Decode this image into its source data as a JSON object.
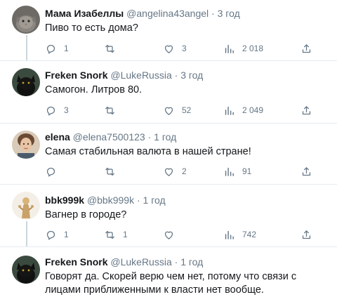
{
  "tweets": [
    {
      "name": "Мама Изабеллы",
      "handle": "@angelina43angel",
      "dot": "·",
      "time": "3 год",
      "text": "Пиво то есть дома?",
      "replies": "1",
      "retweets": "",
      "likes": "3",
      "views": "2 018",
      "avatar": "cat"
    },
    {
      "name": "Freken Snork",
      "handle": "@LukeRussia",
      "dot": "·",
      "time": "3 год",
      "text": "Самогон. Литров 80.",
      "replies": "3",
      "retweets": "",
      "likes": "52",
      "views": "2 049",
      "avatar": "black-cat"
    },
    {
      "name": "elena",
      "handle": "@elena7500123",
      "dot": "·",
      "time": "1 год",
      "text": "Самая стабильная валюта в нашей стране!",
      "replies": "",
      "retweets": "",
      "likes": "2",
      "views": "91",
      "avatar": "portrait"
    },
    {
      "name": "bbk999k",
      "handle": "@bbk999k",
      "dot": "·",
      "time": "1 год",
      "text": "Вагнер в городе?",
      "replies": "1",
      "retweets": "1",
      "likes": "",
      "views": "742",
      "avatar": "statue"
    },
    {
      "name": "Freken Snork",
      "handle": "@LukeRussia",
      "dot": "·",
      "time": "1 год",
      "text": "Говорят да. Скорей верю чем нет, потому что связи с лицами приближенными к власти нет вообще.",
      "avatar": "black-cat"
    }
  ],
  "icons": {
    "reply": "reply-icon",
    "retweet": "retweet-icon",
    "like": "like-icon",
    "views": "views-icon",
    "share": "share-icon"
  },
  "colors": {
    "text": "#14171a",
    "muted": "#657786",
    "divider": "#e6ecf0",
    "thread": "#ccd6dd"
  }
}
